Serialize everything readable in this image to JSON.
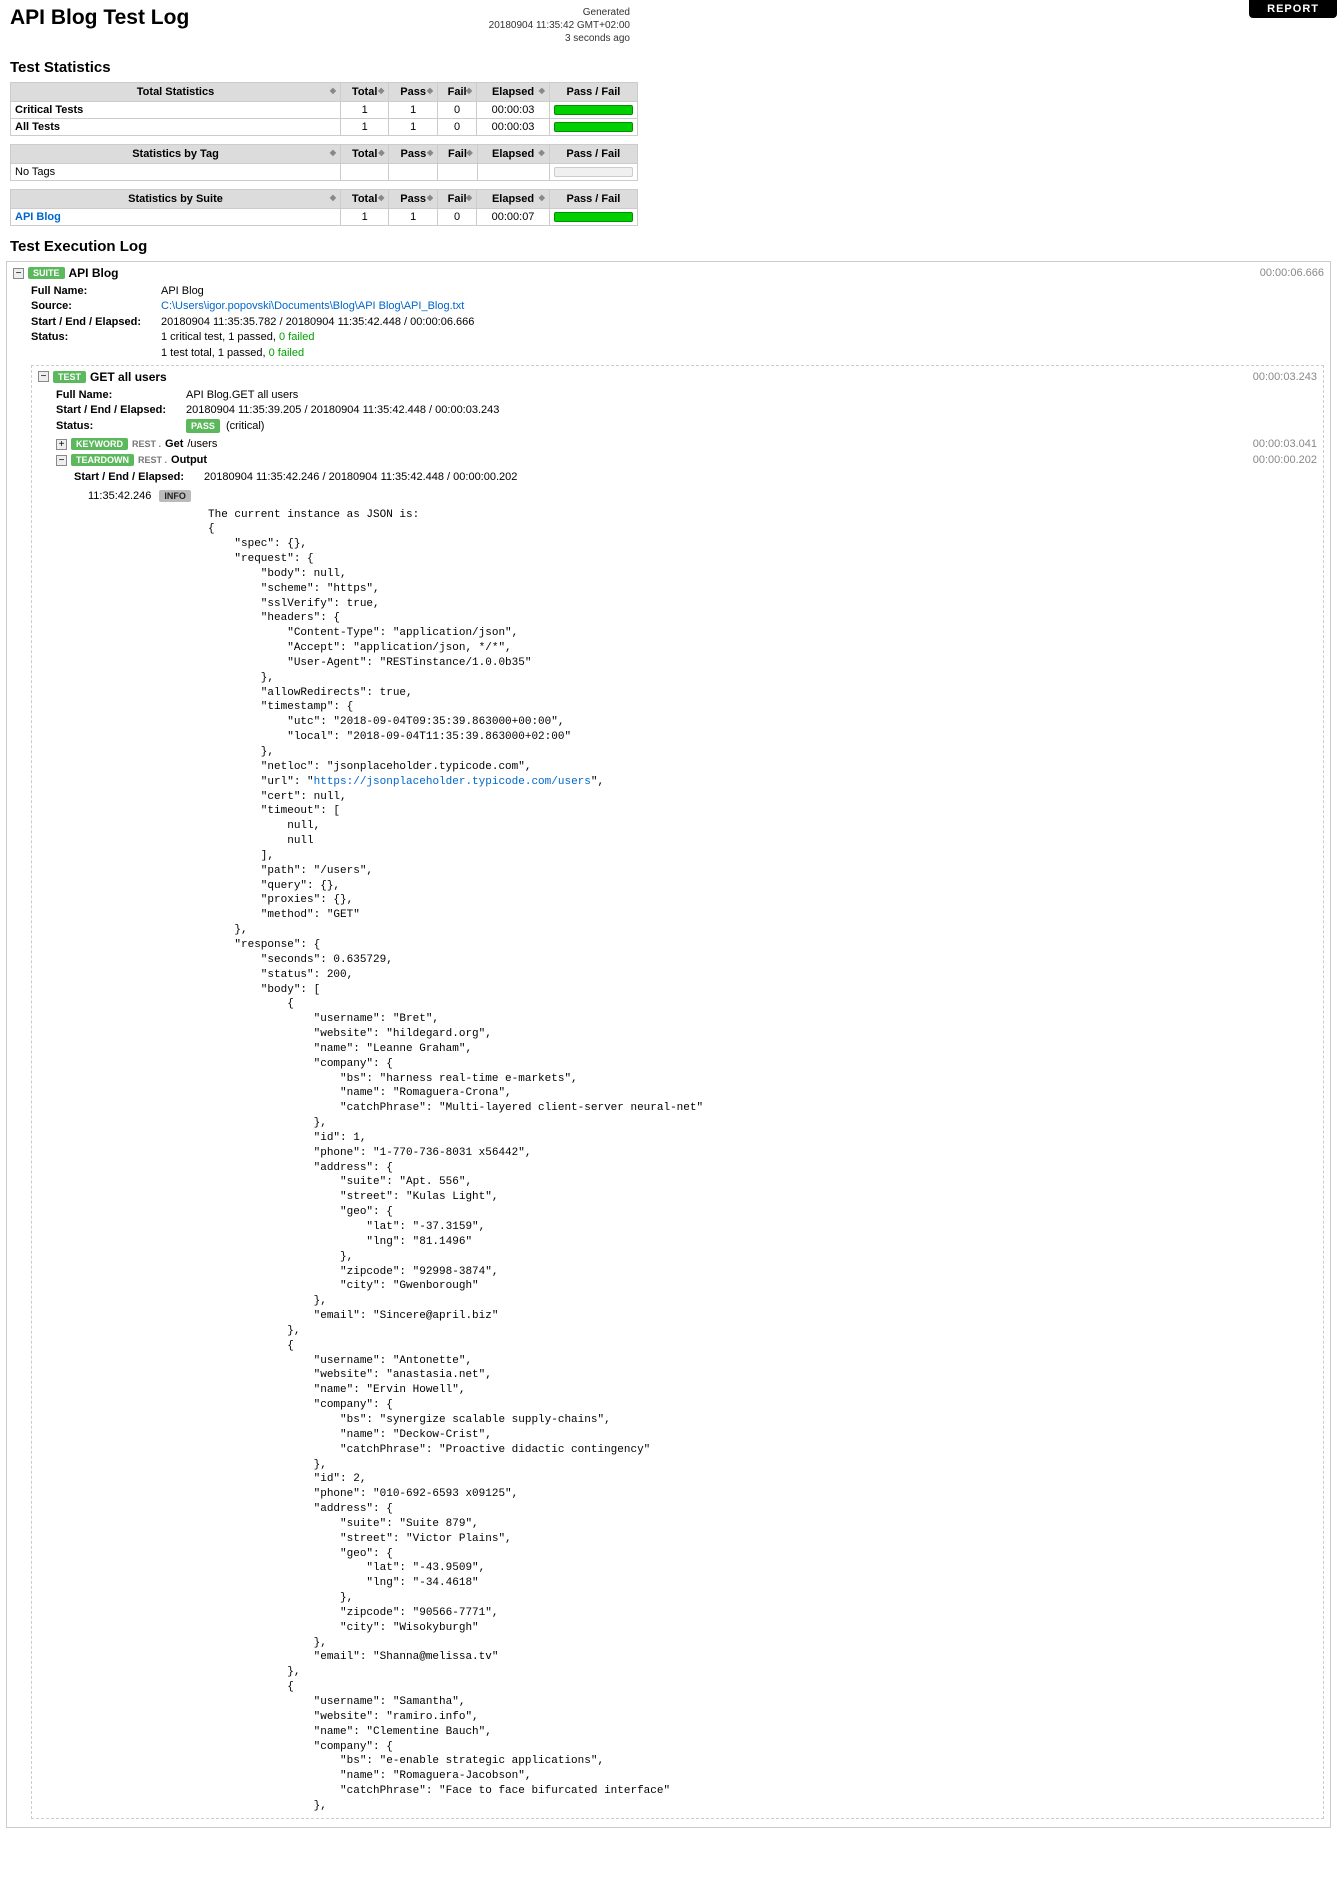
{
  "report_button": "REPORT",
  "title": "API Blog Test Log",
  "generated": {
    "label": "Generated",
    "timestamp": "20180904 11:35:42 GMT+02:00",
    "ago": "3 seconds ago"
  },
  "stats_heading": "Test Statistics",
  "stat_headers": {
    "total_stats": "Total Statistics",
    "by_tag": "Statistics by Tag",
    "by_suite": "Statistics by Suite",
    "total": "Total",
    "pass": "Pass",
    "fail": "Fail",
    "elapsed": "Elapsed",
    "passfail": "Pass / Fail"
  },
  "total_stats_rows": [
    {
      "name": "Critical Tests",
      "total": "1",
      "pass": "1",
      "fail": "0",
      "elapsed": "00:00:03"
    },
    {
      "name": "All Tests",
      "total": "1",
      "pass": "1",
      "fail": "0",
      "elapsed": "00:00:03"
    }
  ],
  "tag_rows": {
    "empty": "No Tags"
  },
  "suite_rows": [
    {
      "name": "API Blog",
      "total": "1",
      "pass": "1",
      "fail": "0",
      "elapsed": "00:00:07"
    }
  ],
  "exec_heading": "Test Execution Log",
  "suite": {
    "badge": "SUITE",
    "name": "API Blog",
    "elapsed": "00:00:06.666",
    "full_name_label": "Full Name:",
    "full_name": "API Blog",
    "source_label": "Source:",
    "source": "C:\\Users\\igor.popovski\\Documents\\Blog\\API Blog\\API_Blog.txt",
    "see_label": "Start / End / Elapsed:",
    "see": "20180904 11:35:35.782 / 20180904 11:35:42.448 / 00:00:06.666",
    "status_label": "Status:",
    "status1": "1 critical test, 1 passed, ",
    "status1b": "0 failed",
    "status2": "1 test total, 1 passed, ",
    "status2b": "0 failed"
  },
  "test": {
    "badge": "TEST",
    "name": "GET all users",
    "elapsed": "00:00:03.243",
    "full_name_label": "Full Name:",
    "full_name": "API Blog.GET all users",
    "see_label": "Start / End / Elapsed:",
    "see": "20180904 11:35:39.205 / 20180904 11:35:42.448 / 00:00:03.243",
    "status_label": "Status:",
    "pass_badge": "PASS",
    "critical": "(critical)"
  },
  "kw1": {
    "badge": "KEYWORD",
    "prefix": "REST .",
    "name": "Get",
    "arg": "/users",
    "elapsed": "00:00:03.041"
  },
  "kw2": {
    "badge": "TEARDOWN",
    "prefix": "REST .",
    "name": "Output",
    "elapsed": "00:00:00.202",
    "see_label": "Start / End / Elapsed:",
    "see": "20180904 11:35:42.246 / 20180904 11:35:42.448 / 00:00:00.202",
    "ts": "11:35:42.246",
    "info": "INFO"
  },
  "json_intro": "The current instance as JSON is:",
  "json_body_pre": "{\n    \"spec\": {},\n    \"request\": {\n        \"body\": null,\n        \"scheme\": \"https\",\n        \"sslVerify\": true,\n        \"headers\": {\n            \"Content-Type\": \"application/json\",\n            \"Accept\": \"application/json, */*\",\n            \"User-Agent\": \"RESTinstance/1.0.0b35\"\n        },\n        \"allowRedirects\": true,\n        \"timestamp\": {\n            \"utc\": \"2018-09-04T09:35:39.863000+00:00\",\n            \"local\": \"2018-09-04T11:35:39.863000+02:00\"\n        },\n        \"netloc\": \"jsonplaceholder.typicode.com\",\n        \"url\": \"",
  "json_url": "https://jsonplaceholder.typicode.com/users",
  "json_body_post": "\",\n        \"cert\": null,\n        \"timeout\": [\n            null,\n            null\n        ],\n        \"path\": \"/users\",\n        \"query\": {},\n        \"proxies\": {},\n        \"method\": \"GET\"\n    },\n    \"response\": {\n        \"seconds\": 0.635729,\n        \"status\": 200,\n        \"body\": [\n            {\n                \"username\": \"Bret\",\n                \"website\": \"hildegard.org\",\n                \"name\": \"Leanne Graham\",\n                \"company\": {\n                    \"bs\": \"harness real-time e-markets\",\n                    \"name\": \"Romaguera-Crona\",\n                    \"catchPhrase\": \"Multi-layered client-server neural-net\"\n                },\n                \"id\": 1,\n                \"phone\": \"1-770-736-8031 x56442\",\n                \"address\": {\n                    \"suite\": \"Apt. 556\",\n                    \"street\": \"Kulas Light\",\n                    \"geo\": {\n                        \"lat\": \"-37.3159\",\n                        \"lng\": \"81.1496\"\n                    },\n                    \"zipcode\": \"92998-3874\",\n                    \"city\": \"Gwenborough\"\n                },\n                \"email\": \"Sincere@april.biz\"\n            },\n            {\n                \"username\": \"Antonette\",\n                \"website\": \"anastasia.net\",\n                \"name\": \"Ervin Howell\",\n                \"company\": {\n                    \"bs\": \"synergize scalable supply-chains\",\n                    \"name\": \"Deckow-Crist\",\n                    \"catchPhrase\": \"Proactive didactic contingency\"\n                },\n                \"id\": 2,\n                \"phone\": \"010-692-6593 x09125\",\n                \"address\": {\n                    \"suite\": \"Suite 879\",\n                    \"street\": \"Victor Plains\",\n                    \"geo\": {\n                        \"lat\": \"-43.9509\",\n                        \"lng\": \"-34.4618\"\n                    },\n                    \"zipcode\": \"90566-7771\",\n                    \"city\": \"Wisokyburgh\"\n                },\n                \"email\": \"Shanna@melissa.tv\"\n            },\n            {\n                \"username\": \"Samantha\",\n                \"website\": \"ramiro.info\",\n                \"name\": \"Clementine Bauch\",\n                \"company\": {\n                    \"bs\": \"e-enable strategic applications\",\n                    \"name\": \"Romaguera-Jacobson\",\n                    \"catchPhrase\": \"Face to face bifurcated interface\"\n                },"
}
